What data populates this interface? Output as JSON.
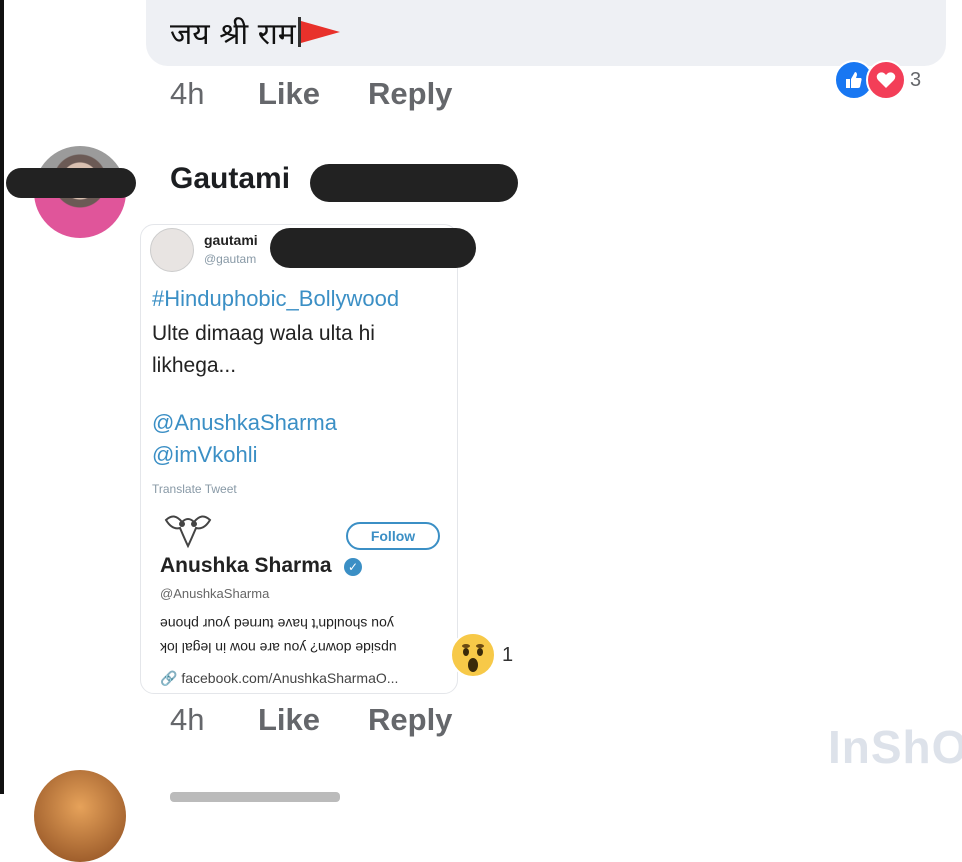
{
  "comment1": {
    "text": "जय श्री राम",
    "time": "4h",
    "like_label": "Like",
    "reply_label": "Reply",
    "reaction_icons": [
      "like-icon",
      "love-icon"
    ],
    "reaction_count": "3"
  },
  "comment2": {
    "author": "Gautami",
    "time": "4h",
    "like_label": "Like",
    "reply_label": "Reply",
    "reaction_icon": "wow-icon",
    "reaction_count": "1",
    "tweet": {
      "name": "gautami",
      "handle": "@gautam",
      "hashtag": "#Hinduphobic_Bollywood",
      "body_line1": "Ulte dimaag wala ulta hi",
      "body_line2": "likhega...",
      "mention1": "@AnushkaSharma",
      "mention2": "@imVkohli",
      "translate_label": "Translate Tweet",
      "quoted": {
        "follow_label": "Follow",
        "name": "Anushka Sharma",
        "handle": "@AnushkaSharma",
        "upside_line1": "upside down? you are now in legal lok",
        "upside_line2": "you shouldn't have turned your phone",
        "link": "facebook.com/AnushkaSharmaO..."
      }
    }
  },
  "watermark": "InShO",
  "colors": {
    "link_blue": "#3b8fc5",
    "like_blue": "#1877f2",
    "love_red": "#f33e58",
    "bubble_gray": "#eef0f4",
    "meta_gray": "#65676b"
  }
}
